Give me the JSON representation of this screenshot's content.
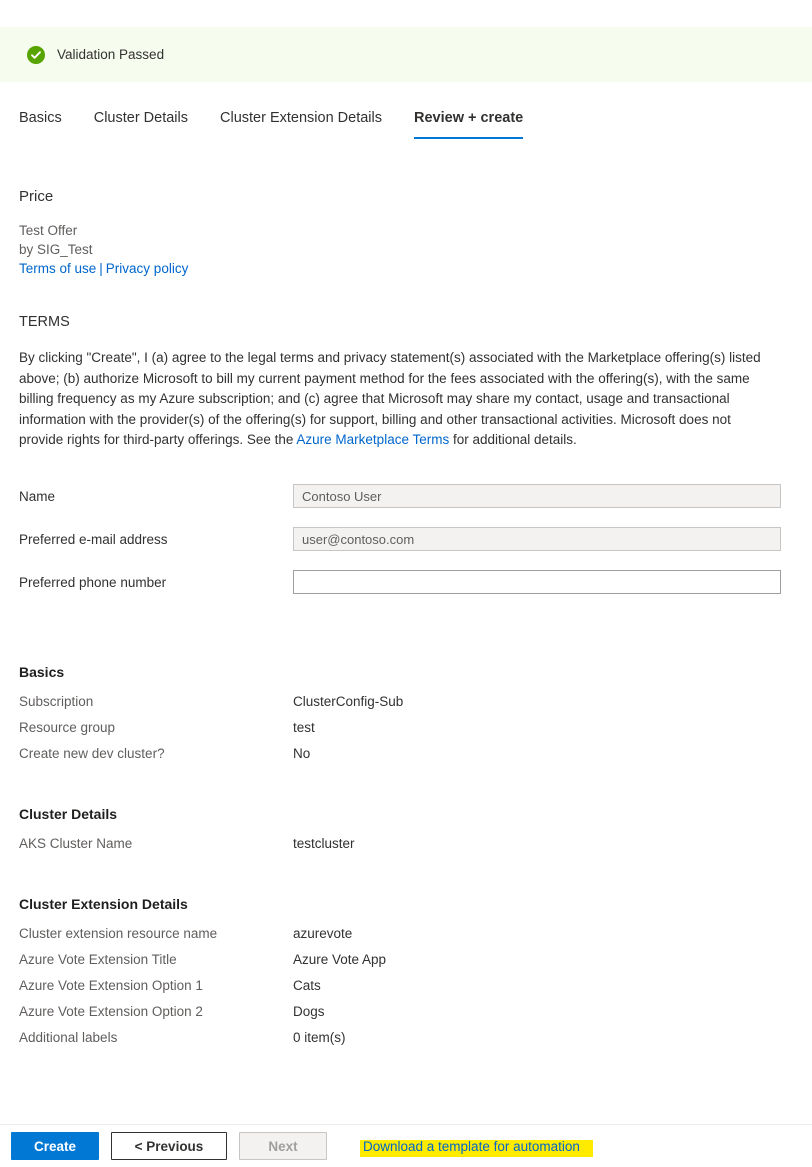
{
  "validation": {
    "icon": "check-circle-icon",
    "message": "Validation Passed",
    "banner_color": "#f6fcee",
    "icon_color": "#57a300"
  },
  "tabs": [
    {
      "label": "Basics",
      "active": false
    },
    {
      "label": "Cluster Details",
      "active": false
    },
    {
      "label": "Cluster Extension Details",
      "active": false
    },
    {
      "label": "Review + create",
      "active": true
    }
  ],
  "price": {
    "heading": "Price",
    "offer_name": "Test Offer",
    "publisher": "by SIG_Test",
    "terms_of_use_label": "Terms of use",
    "separator": "|",
    "privacy_policy_label": "Privacy policy"
  },
  "terms": {
    "heading": "TERMS",
    "body_part1": "By clicking \"Create\", I (a) agree to the legal terms and privacy statement(s) associated with the Marketplace offering(s) listed above; (b) authorize Microsoft to bill my current payment method for the fees associated with the offering(s), with the same billing frequency as my Azure subscription; and (c) agree that Microsoft may share my contact, usage and transactional information with the provider(s) of the offering(s) for support, billing and other transactional activities. Microsoft does not provide rights for third-party offerings. See the ",
    "link_label": "Azure Marketplace Terms",
    "body_part2": " for additional details."
  },
  "contact_form": {
    "fields": [
      {
        "label": "Name",
        "value": "Contoso User",
        "placeholder": "",
        "disabled": true
      },
      {
        "label": "Preferred e-mail address",
        "value": "user@contoso.com",
        "placeholder": "",
        "disabled": true
      },
      {
        "label": "Preferred phone number",
        "value": "",
        "placeholder": "",
        "disabled": false
      }
    ]
  },
  "summary": [
    {
      "heading": "Basics",
      "rows": [
        {
          "key": "Subscription",
          "value": "ClusterConfig-Sub"
        },
        {
          "key": "Resource group",
          "value": "test"
        },
        {
          "key": "Create new dev cluster?",
          "value": "No"
        }
      ]
    },
    {
      "heading": "Cluster Details",
      "rows": [
        {
          "key": "AKS Cluster Name",
          "value": "testcluster"
        }
      ]
    },
    {
      "heading": "Cluster Extension Details",
      "rows": [
        {
          "key": "Cluster extension resource name",
          "value": "azurevote"
        },
        {
          "key": "Azure Vote Extension Title",
          "value": "Azure Vote App"
        },
        {
          "key": "Azure Vote Extension Option 1",
          "value": "Cats"
        },
        {
          "key": "Azure Vote Extension Option 2",
          "value": "Dogs"
        },
        {
          "key": "Additional labels",
          "value": "0 item(s)"
        }
      ]
    }
  ],
  "footer": {
    "create_label": "Create",
    "previous_label": "< Previous",
    "next_label": "Next",
    "next_disabled": true,
    "download_link_label": "Download a template for automation",
    "highlight_color": "#ffeb00",
    "primary_color": "#0078d4"
  }
}
